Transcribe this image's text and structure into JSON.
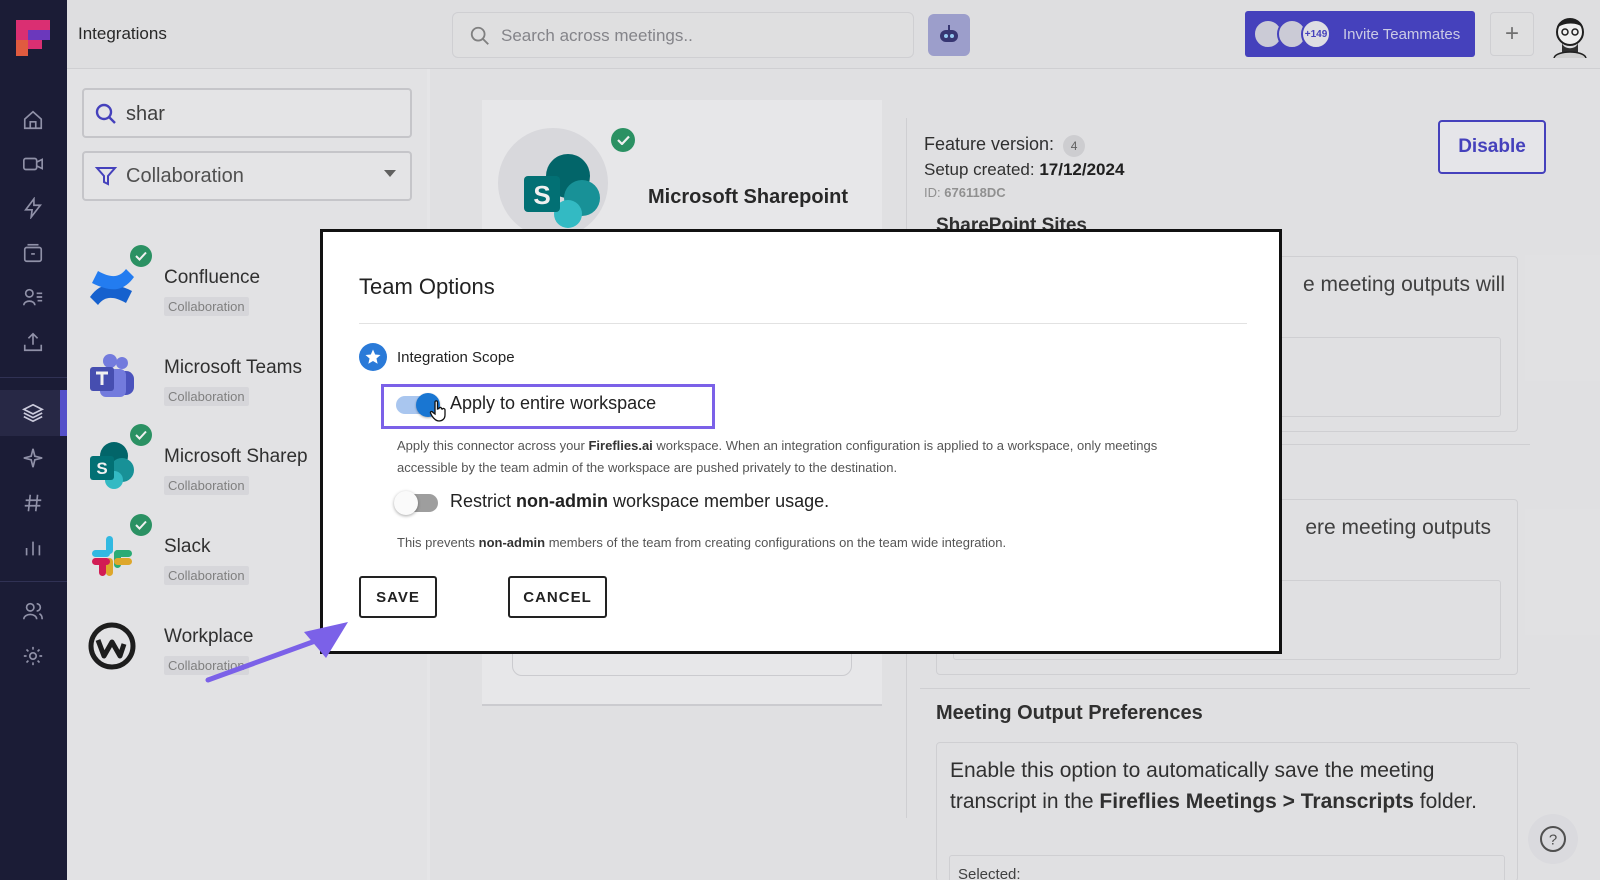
{
  "app": {
    "page_title": "Integrations",
    "colors": {
      "rail": "#1d1e3a",
      "accent": "#4a46c8",
      "success": "#2e9b6a",
      "toggle_on": "#1976d2",
      "highlight": "#7b61e8"
    }
  },
  "topbar": {
    "search_placeholder": "Search across meetings..",
    "invite_count": "+149",
    "invite_label": "Invite Teammates",
    "plus_label": "+"
  },
  "filters": {
    "search_value": "shar",
    "category": "Collaboration"
  },
  "integrations": [
    {
      "name": "Confluence",
      "category": "Collaboration",
      "connected": true
    },
    {
      "name": "Microsoft Teams",
      "category": "Collaboration",
      "connected": false
    },
    {
      "name": "Microsoft Sharep",
      "category": "Collaboration",
      "connected": true
    },
    {
      "name": "Slack",
      "category": "Collaboration",
      "connected": true
    },
    {
      "name": "Workplace",
      "category": "Collaboration",
      "connected": false
    }
  ],
  "detail": {
    "integration_name": "Microsoft Sharepoint",
    "feature_version_label": "Feature version:",
    "feature_version": "4",
    "setup_label": "Setup created:",
    "setup_date": "17/12/2024",
    "id_label": "ID:",
    "id_value": "676118DC",
    "disable_label": "Disable",
    "sites_heading": "SharePoint Sites",
    "box1_text": "e meeting outputs will",
    "box2_text": "ere meeting outputs",
    "meeting_output_heading": "Meeting Output Preferences",
    "meeting_output_desc_1": "Enable this option to automatically save the meeting transcript in the ",
    "meeting_output_desc_bold": "Fireflies Meetings > Transcripts",
    "meeting_output_desc_2": " folder.",
    "selected_label": "Selected:",
    "help_label": "?"
  },
  "modal": {
    "title": "Team Options",
    "scope_label": "Integration Scope",
    "option1_label": "Apply to entire workspace",
    "option1_enabled": true,
    "option1_desc_1": "Apply this connector across your ",
    "option1_desc_bold": "Fireflies.ai",
    "option1_desc_2": " workspace. When an integration configuration is applied to a workspace, only meetings accessible by the team admin of the workspace are pushed privately to the destination.",
    "option2_label_1": "Restrict ",
    "option2_label_bold": "non-admin",
    "option2_label_2": " workspace member usage.",
    "option2_enabled": false,
    "option2_desc_1": "This prevents ",
    "option2_desc_bold": "non-admin",
    "option2_desc_2": " members of the team from creating configurations on the team wide integration.",
    "save_label": "SAVE",
    "cancel_label": "CANCEL"
  }
}
